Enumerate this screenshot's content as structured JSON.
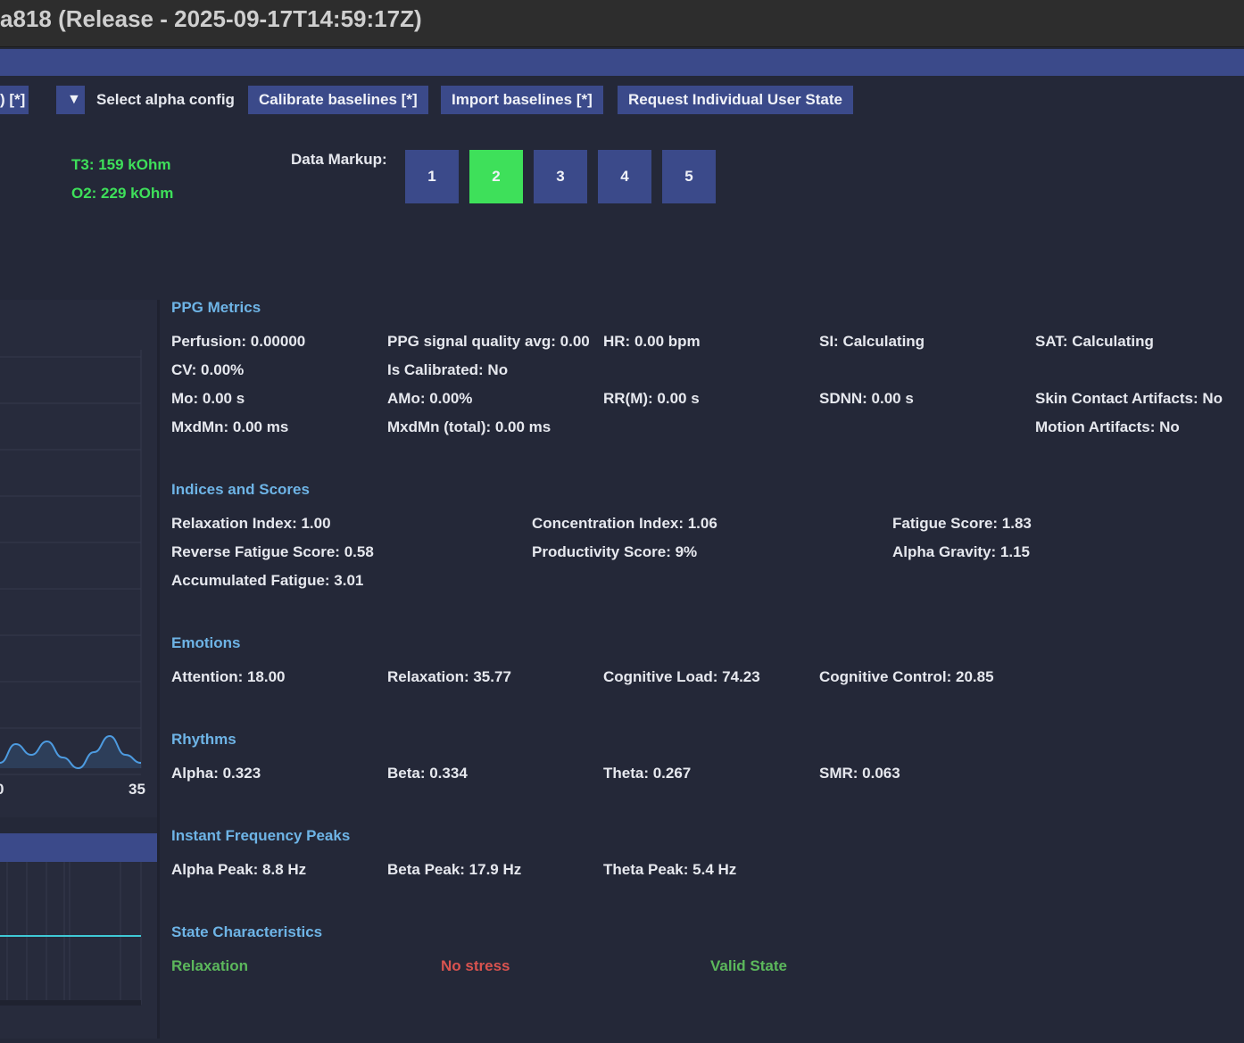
{
  "window": {
    "title": "a818 (Release - 2025-09-17T14:59:17Z)"
  },
  "toolbar": {
    "partial_label": ") [*]",
    "dropdown_glyph": "▼",
    "select_alpha_label": "Select alpha config",
    "calibrate_label": "Calibrate baselines [*]",
    "import_label": "Import baselines [*]",
    "request_label": "Request Individual User State"
  },
  "impedance": {
    "t3": "T3: 159 kOhm",
    "o2": "O2: 229 kOhm"
  },
  "markup": {
    "label": "Data Markup:",
    "buttons": [
      "1",
      "2",
      "3",
      "4",
      "5"
    ],
    "active_index": 1,
    "active_color": "#3ee05a"
  },
  "chart_data": {
    "type": "area",
    "x_tick_labels": [
      "0",
      "35"
    ],
    "series": [
      {
        "values": [
          0.02,
          0.09,
          0.05,
          0.1,
          0.04,
          0.0,
          0.06,
          0.12,
          0.05,
          0.02
        ]
      }
    ]
  },
  "ppg": {
    "title": "PPG Metrics",
    "perfusion": "Perfusion: 0.00000",
    "signal_quality": "PPG signal quality avg: 0.00",
    "hr": "HR: 0.00 bpm",
    "si": "SI: Calculating",
    "sat": "SAT: Calculating",
    "cv": "CV: 0.00%",
    "is_calibrated": "Is Calibrated: No",
    "mo": "Mo: 0.00 s",
    "amo": "AMo: 0.00%",
    "rrm": "RR(M): 0.00 s",
    "sdnn": "SDNN: 0.00 s",
    "skin_contact": "Skin Contact Artifacts: No",
    "mxdmn": "MxdMn: 0.00 ms",
    "mxdmn_total": "MxdMn (total): 0.00 ms",
    "motion": "Motion Artifacts: No"
  },
  "indices": {
    "title": "Indices and Scores",
    "relaxation_index": "Relaxation Index: 1.00",
    "concentration_index": "Concentration Index: 1.06",
    "fatigue_score": "Fatigue Score: 1.83",
    "reverse_fatigue": "Reverse Fatigue Score: 0.58",
    "productivity": "Productivity Score: 9%",
    "alpha_gravity": "Alpha Gravity: 1.15",
    "accumulated_fatigue": "Accumulated Fatigue: 3.01"
  },
  "emotions": {
    "title": "Emotions",
    "attention": "Attention: 18.00",
    "relaxation": "Relaxation: 35.77",
    "cognitive_load": "Cognitive Load: 74.23",
    "cognitive_control": "Cognitive Control: 20.85"
  },
  "rhythms": {
    "title": "Rhythms",
    "alpha": "Alpha: 0.323",
    "beta": "Beta: 0.334",
    "theta": "Theta: 0.267",
    "smr": "SMR: 0.063"
  },
  "peaks": {
    "title": "Instant Frequency Peaks",
    "alpha": "Alpha Peak: 8.8 Hz",
    "beta": "Beta Peak: 17.9 Hz",
    "theta": "Theta Peak: 5.4 Hz"
  },
  "state": {
    "title": "State Characteristics",
    "relaxation": "Relaxation",
    "stress": "No stress",
    "valid": "Valid State",
    "colors": {
      "good": "#5cb85c",
      "bad": "#d9534f"
    }
  }
}
